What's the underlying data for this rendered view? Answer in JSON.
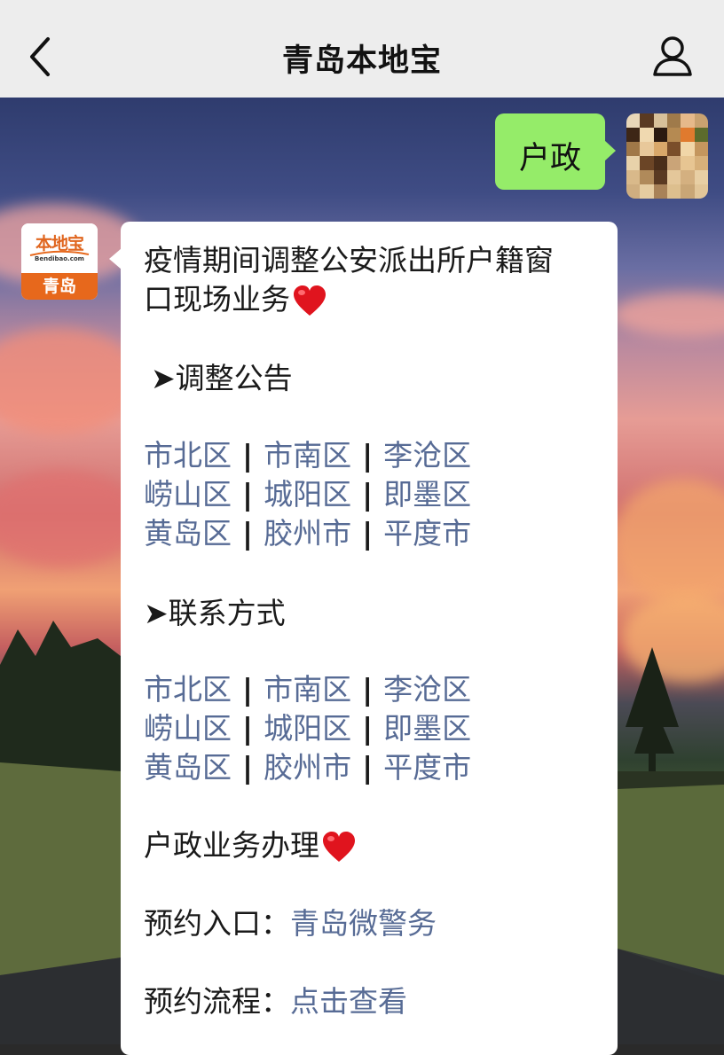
{
  "header": {
    "title": "青岛本地宝"
  },
  "my_message": {
    "text": "户政"
  },
  "brand": {
    "name": "本地宝",
    "site": "Bendibao.com",
    "city": "青岛"
  },
  "card": {
    "title_line1": "疫情期间调整公安派出所户籍窗",
    "title_line2": "口现场业务",
    "section1": "➤调整公告",
    "districts1": [
      [
        "市北区",
        "市南区",
        "李沧区"
      ],
      [
        "崂山区",
        "城阳区",
        "即墨区"
      ],
      [
        "黄岛区",
        "胶州市",
        "平度市"
      ]
    ],
    "section2": "➤联系方式",
    "districts2": [
      [
        "市北区",
        "市南区",
        "李沧区"
      ],
      [
        "崂山区",
        "城阳区",
        "即墨区"
      ],
      [
        "黄岛区",
        "胶州市",
        "平度市"
      ]
    ],
    "separator": "|",
    "biz_title": "户政业务办理",
    "entry_label": "预约入口：",
    "entry_link": "青岛微警务",
    "flow_label": "预约流程：",
    "flow_link": "点击查看"
  },
  "colors": {
    "link": "#576b95",
    "bubble_green": "#95ec69",
    "brand_orange": "#e7681c",
    "heart": "#e0141e"
  },
  "icons": [
    "chevron-left-icon",
    "user-profile-icon",
    "heart-icon"
  ]
}
